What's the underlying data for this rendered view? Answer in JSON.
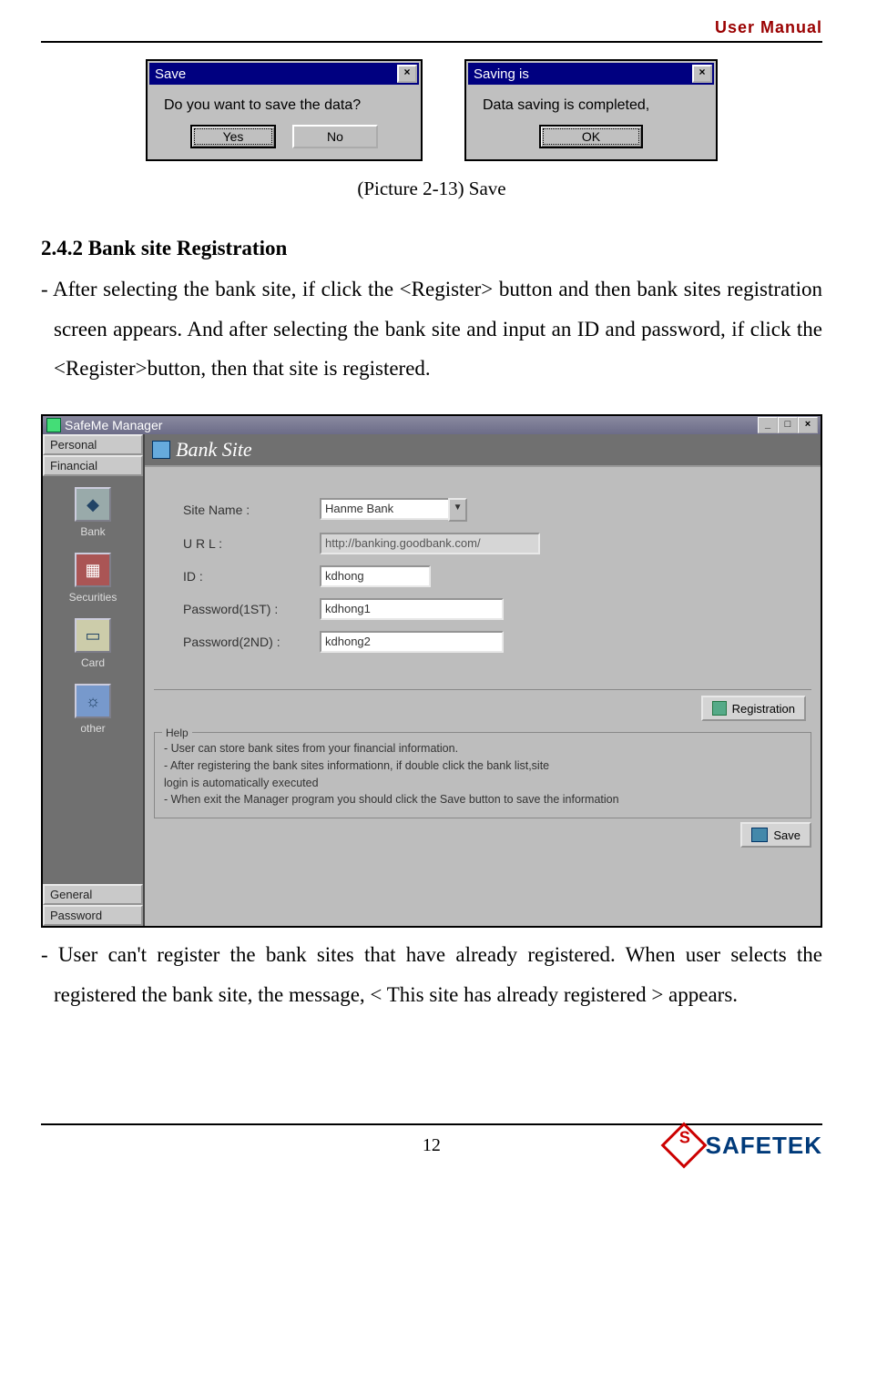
{
  "header": {
    "title": "User Manual"
  },
  "dialogs": {
    "save": {
      "title": "Save",
      "body": "Do you want to save the data?",
      "yes": "Yes",
      "no": "No"
    },
    "saved": {
      "title": "Saving is",
      "body": "Data saving is completed,",
      "ok": "OK"
    }
  },
  "fig_caption": "(Picture 2-13) Save",
  "section": {
    "heading": "2.4.2 Bank site Registration",
    "para1_lead": "- After selecting the bank site, if click the <Register> button and then bank sites registration screen appears. And after selecting the bank site and input an ID and password, if click the <Register>button, then that site is registered.",
    "para2": "- User can't register the bank sites that have already registered. When user selects the registered the bank site, the message, < This site has already registered > appears."
  },
  "app": {
    "title": "SafeMe Manager",
    "tabs": {
      "personal": "Personal",
      "financial": "Financial",
      "general": "General",
      "password": "Password"
    },
    "side": {
      "bank": "Bank",
      "securities": "Securities",
      "card": "Card",
      "other": "other"
    },
    "pane_title": "Bank Site",
    "form": {
      "site_name_label": "Site Name :",
      "site_name_value": "Hanme Bank",
      "url_label": "U R L :",
      "url_value": "http://banking.goodbank.com/",
      "id_label": "ID :",
      "id_value": "kdhong",
      "pw1_label": "Password(1ST) :",
      "pw1_value": "kdhong1",
      "pw2_label": "Password(2ND) :",
      "pw2_value": "kdhong2"
    },
    "registration_btn": "Registration",
    "help": {
      "legend": "Help",
      "l1": "- User can store bank sites from your financial information.",
      "l2": "- After registering the bank sites informationn, if double click the bank list,site",
      "l3": "  login is automatically executed",
      "l4": "- When exit the Manager program you should click the Save button to save the information"
    },
    "save_btn": "Save"
  },
  "footer": {
    "page": "12",
    "brand": "SAFETEK"
  }
}
